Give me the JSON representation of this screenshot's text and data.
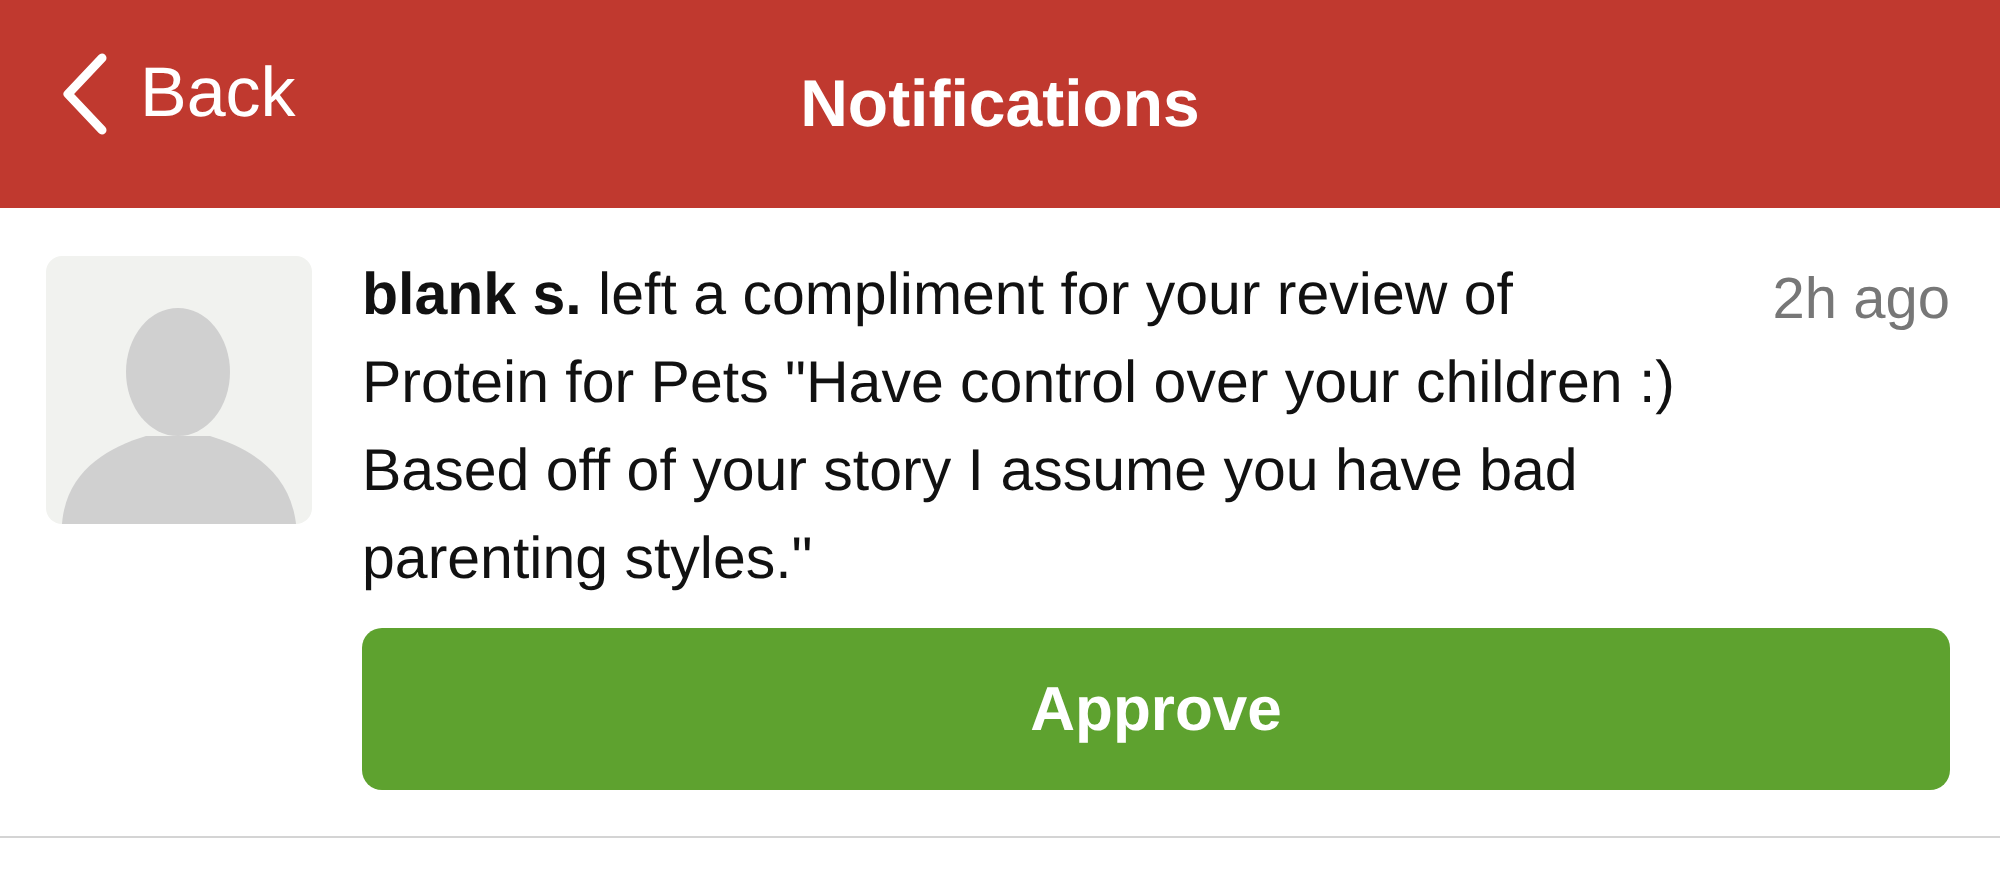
{
  "header": {
    "back_label": "Back",
    "title": "Notifications"
  },
  "notifications": [
    {
      "message": "**blank s.** left a compliment for your review of Protein for Pets \"Have control over your children :) Based off of your story I assume you have bad parenting styles.\"",
      "time": "2h ago",
      "action": "Approve"
    }
  ]
}
